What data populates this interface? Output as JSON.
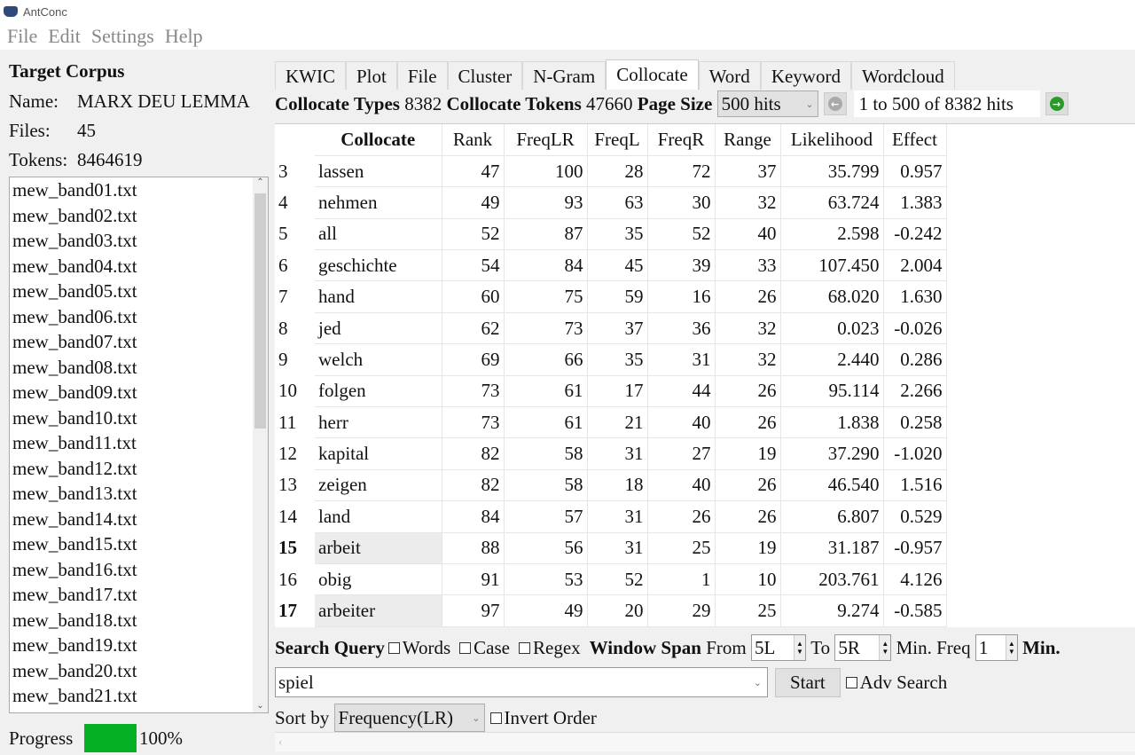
{
  "app": {
    "title": "AntConc"
  },
  "menu": [
    "File",
    "Edit",
    "Settings",
    "Help"
  ],
  "corpus": {
    "heading": "Target Corpus",
    "name_label": "Name:",
    "name": "MARX DEU LEMMA",
    "files_label": "Files:",
    "files": "45",
    "tokens_label": "Tokens:",
    "tokens": "8464619",
    "files_list": [
      "mew_band01.txt",
      "mew_band02.txt",
      "mew_band03.txt",
      "mew_band04.txt",
      "mew_band05.txt",
      "mew_band06.txt",
      "mew_band07.txt",
      "mew_band08.txt",
      "mew_band09.txt",
      "mew_band10.txt",
      "mew_band11.txt",
      "mew_band12.txt",
      "mew_band13.txt",
      "mew_band14.txt",
      "mew_band15.txt",
      "mew_band16.txt",
      "mew_band17.txt",
      "mew_band18.txt",
      "mew_band19.txt",
      "mew_band20.txt",
      "mew_band21.txt"
    ],
    "progress_label": "Progress",
    "progress": "100%",
    "progress_value": 100
  },
  "tabs": [
    "KWIC",
    "Plot",
    "File",
    "Cluster",
    "N-Gram",
    "Collocate",
    "Word",
    "Keyword",
    "Wordcloud"
  ],
  "active_tab": "Collocate",
  "stats": {
    "types_label": "Collocate Types",
    "types": "8382",
    "tokens_label": "Collocate Tokens",
    "tokens": "47660",
    "page_size_label": "Page Size",
    "page_size": "500 hits",
    "range": "1 to 500 of 8382 hits"
  },
  "table": {
    "headers": [
      "Collocate",
      "Rank",
      "FreqLR",
      "FreqL",
      "FreqR",
      "Range",
      "Likelihood",
      "Effect"
    ],
    "rows": [
      [
        "3",
        "lassen",
        "47",
        "100",
        "28",
        "72",
        "37",
        "35.799",
        "0.957"
      ],
      [
        "4",
        "nehmen",
        "49",
        "93",
        "63",
        "30",
        "32",
        "63.724",
        "1.383"
      ],
      [
        "5",
        "all",
        "52",
        "87",
        "35",
        "52",
        "40",
        "2.598",
        "-0.242"
      ],
      [
        "6",
        "geschichte",
        "54",
        "84",
        "45",
        "39",
        "33",
        "107.450",
        "2.004"
      ],
      [
        "7",
        "hand",
        "60",
        "75",
        "59",
        "16",
        "26",
        "68.020",
        "1.630"
      ],
      [
        "8",
        "jed",
        "62",
        "73",
        "37",
        "36",
        "32",
        "0.023",
        "-0.026"
      ],
      [
        "9",
        "welch",
        "69",
        "66",
        "35",
        "31",
        "32",
        "2.440",
        "0.286"
      ],
      [
        "10",
        "folgen",
        "73",
        "61",
        "17",
        "44",
        "26",
        "95.114",
        "2.266"
      ],
      [
        "11",
        "herr",
        "73",
        "61",
        "21",
        "40",
        "26",
        "1.838",
        "0.258"
      ],
      [
        "12",
        "kapital",
        "82",
        "58",
        "31",
        "27",
        "19",
        "37.290",
        "-1.020"
      ],
      [
        "13",
        "zeigen",
        "82",
        "58",
        "18",
        "40",
        "26",
        "46.540",
        "1.516"
      ],
      [
        "14",
        "land",
        "84",
        "57",
        "31",
        "26",
        "26",
        "6.807",
        "0.529"
      ],
      [
        "15",
        "arbeit",
        "88",
        "56",
        "31",
        "25",
        "19",
        "31.187",
        "-0.957"
      ],
      [
        "16",
        "obig",
        "91",
        "53",
        "52",
        "1",
        "10",
        "203.761",
        "4.126"
      ],
      [
        "17",
        "arbeiter",
        "97",
        "49",
        "20",
        "29",
        "25",
        "9.274",
        "-0.585"
      ]
    ],
    "selected_rows": [
      "15",
      "17"
    ]
  },
  "search": {
    "label": "Search Query",
    "words": "Words",
    "case": "Case",
    "regex": "Regex",
    "window_span": "Window Span",
    "from_label": "From",
    "from": "5L",
    "to_label": "To",
    "to": "5R",
    "min_freq_label": "Min. Freq",
    "min_freq": "1",
    "min_label": "Min.",
    "query": "spiel",
    "start": "Start",
    "adv": "Adv Search",
    "sort_label": "Sort by",
    "sort": "Frequency(LR)",
    "invert": "Invert Order"
  }
}
